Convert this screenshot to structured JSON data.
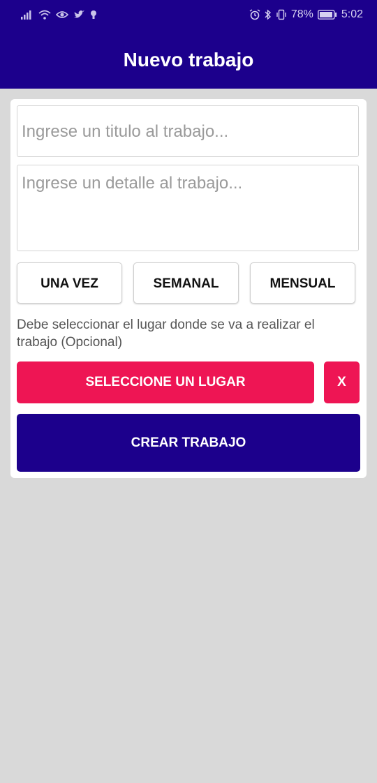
{
  "status_bar": {
    "battery_text": "78%",
    "time": "5:02",
    "left_icons": [
      "signal-icon",
      "wifi-icon",
      "eye-icon",
      "twitter-icon",
      "lightbulb-icon"
    ],
    "right_icons": [
      "alarm-icon",
      "bluetooth-icon",
      "vibrate-icon",
      "battery-icon"
    ]
  },
  "appbar": {
    "title": "Nuevo trabajo",
    "color": "#1c008c"
  },
  "form": {
    "title_placeholder": "Ingrese un titulo al trabajo...",
    "detail_placeholder": "Ingrese un detalle al trabajo...",
    "frequency_options": [
      "UNA VEZ",
      "SEMANAL",
      "MENSUAL"
    ],
    "place_hint": "Debe seleccionar el lugar donde se va a realizar el trabajo (Opcional)",
    "select_place_label": "SELECCIONE UN LUGAR",
    "clear_place_label": "X",
    "create_label": "CREAR TRABAJO",
    "accent_color": "#ee1554"
  }
}
